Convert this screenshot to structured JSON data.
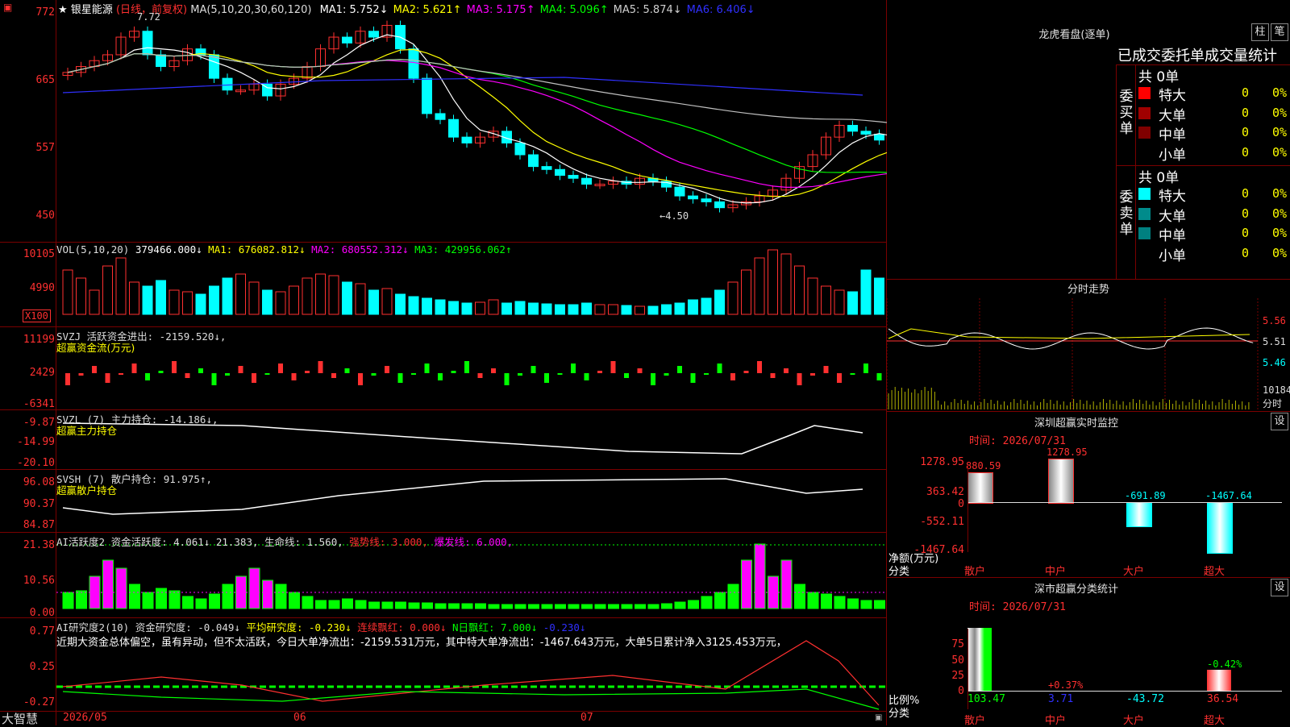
{
  "header": {
    "star": "★",
    "title": "银星能源",
    "period": "(日线，前复权)",
    "ma_prefix": "MA(5,10,20,30,60,120)",
    "ma": [
      {
        "label": "MA1: 5.752↓",
        "color": "#ffffff"
      },
      {
        "label": "MA2: 5.621↑",
        "color": "#ffff00"
      },
      {
        "label": "MA3: 5.175↑",
        "color": "#ff00ff"
      },
      {
        "label": "MA4: 5.096↑",
        "color": "#00ff00"
      },
      {
        "label": "MA5: 5.874↓",
        "color": "#d0d0d0"
      },
      {
        "label": "MA6: 6.406↓",
        "color": "#3030ff"
      }
    ]
  },
  "price_axis": [
    "772",
    "665",
    "557",
    "450"
  ],
  "price_marks": {
    "high": "7.72",
    "low": "←4.50"
  },
  "vol": {
    "axis": [
      "10105",
      "4990"
    ],
    "unit": "X100",
    "line": "VOL(5,10,20)",
    "value": "379466.000↓",
    "ma1": "MA1: 676082.812↓",
    "ma2": "MA2: 680552.312↓",
    "ma3": "MA3: 429956.062↑"
  },
  "svzj": {
    "axis": [
      "11199",
      "2429",
      "-6341"
    ],
    "line1": "SVZJ  活跃资金进出: -2159.520↓,",
    "line2": "超赢资金流(万元)"
  },
  "svzl": {
    "axis": [
      "-9.87",
      "-14.99",
      "-20.10"
    ],
    "line1": "SVZL (7) 主力持仓: -14.186↓,",
    "line2": "超赢主力持仓"
  },
  "svsh": {
    "axis": [
      "96.08",
      "90.37",
      "84.87"
    ],
    "line1": "SVSH (7) 散户持仓: 91.975↑,",
    "line2": "超赢散户持仓"
  },
  "active": {
    "axis": [
      "21.38",
      "10.56",
      "0.00"
    ],
    "label": "AI活跃度2 资金活跃度: 4.061↓ 21.383, 生命线: 1.560,",
    "strong": "强势线: 3.000,",
    "burst": "爆发线: 6.000,"
  },
  "research": {
    "axis": [
      "0.77",
      "0.25",
      "-0.27"
    ],
    "label": "AI研究度2(10) 资金研究度: -0.049↓",
    "avg": "平均研究度: -0.230↓",
    "streak": "连续飘红: 0.000↓",
    "nday": "N日飘红: 7.000↓",
    "last": "-0.230↓",
    "comment": "近期大资金总体偏空，虽有异动，但不太活跃，今日大单净流出：-2159.531万元，其中特大单净流出：-1467.643万元，大单5日累计净入3125.453万元，"
  },
  "xaxis": [
    "2026/05",
    "06",
    "07"
  ],
  "brand": "大智慧",
  "dragon": {
    "title": "龙虎看盘(逐单)",
    "btn1": "柱",
    "btn2": "笔",
    "subtitle": "已成交委托单成交量统计",
    "buy_label": "委买单",
    "sell_label": "委卖单",
    "buy_total": "共 0单",
    "sell_total": "共 0单",
    "buy_rows": [
      {
        "name": "特大",
        "v": "0",
        "p": "0%",
        "c": "#ff0000"
      },
      {
        "name": "大单",
        "v": "0",
        "p": "0%",
        "c": "#a00000"
      },
      {
        "name": "中单",
        "v": "0",
        "p": "0%",
        "c": "#800000"
      },
      {
        "name": "小单",
        "v": "0",
        "p": "0%",
        "c": "#000000"
      }
    ],
    "sell_rows": [
      {
        "name": "特大",
        "v": "0",
        "p": "0%",
        "c": "#00ffff"
      },
      {
        "name": "大单",
        "v": "0",
        "p": "0%",
        "c": "#008b8b"
      },
      {
        "name": "中单",
        "v": "0",
        "p": "0%",
        "c": "#008080"
      },
      {
        "name": "小单",
        "v": "0",
        "p": "0%",
        "c": "#000000"
      }
    ]
  },
  "intraday": {
    "title": "分时走势",
    "axis": [
      "5.56",
      "5.51",
      "5.46"
    ],
    "vol": "10184",
    "unit": "分时"
  },
  "monitor": {
    "title": "深圳超赢实时监控",
    "btn": "设",
    "time": "时间: 2026/07/31",
    "axis": [
      "1278.95",
      "363.42",
      "0",
      "-552.11",
      "-1467.64"
    ],
    "ylabel": "净额(万元)",
    "xlabel": "分类",
    "bars": [
      {
        "cat": "散户",
        "value": 880.59,
        "label": "880.59"
      },
      {
        "cat": "中户",
        "value": 1278.95,
        "label": "1278.95"
      },
      {
        "cat": "大户",
        "value": -691.89,
        "label": "-691.89"
      },
      {
        "cat": "超大",
        "value": -1467.64,
        "label": "-1467.64"
      }
    ]
  },
  "stats": {
    "title": "深市超赢分类统计",
    "btn": "设",
    "time": "时间: 2026/07/31",
    "axis": [
      "75",
      "50",
      "25",
      "0"
    ],
    "ylabel": "比例%",
    "xlabel": "分类",
    "bars": [
      {
        "cat": "散户",
        "pct": "",
        "value": "103.47"
      },
      {
        "cat": "中户",
        "pct": "+0.37%",
        "value": "3.71"
      },
      {
        "cat": "大户",
        "pct": "",
        "value": "-43.72"
      },
      {
        "cat": "超大",
        "pct": "-0.42%",
        "value": "36.54"
      }
    ]
  },
  "colors": {
    "grid": "#7a0000",
    "up": "#ff0000",
    "down": "#00ffff",
    "axis_text": "#ff3030"
  }
}
